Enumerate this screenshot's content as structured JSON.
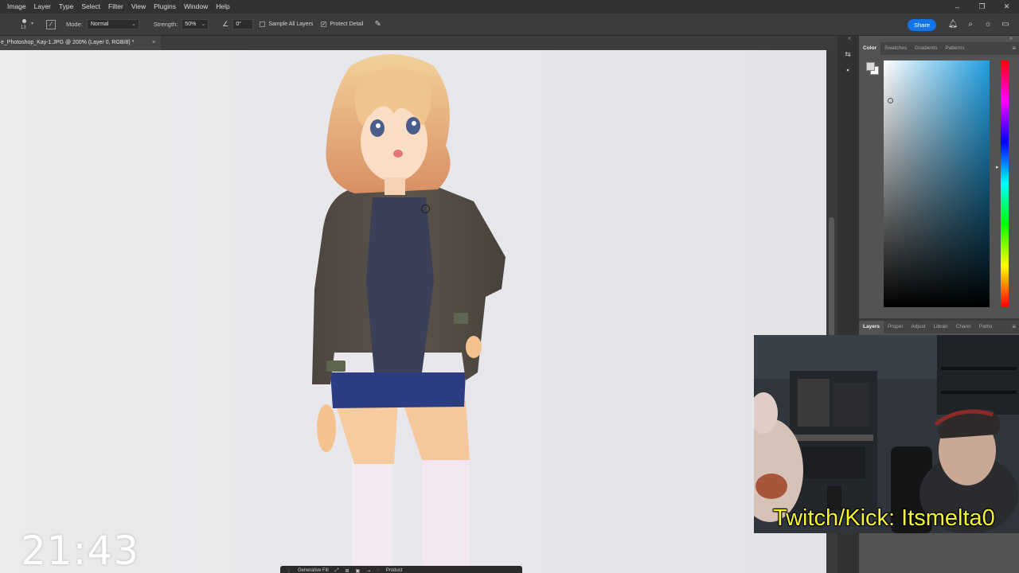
{
  "menu": [
    "Image",
    "Layer",
    "Type",
    "Select",
    "Filter",
    "View",
    "Plugins",
    "Window",
    "Help"
  ],
  "window_controls": {
    "minimize": "–",
    "restore": "❐",
    "close": "✕"
  },
  "options": {
    "brush_size": "13",
    "mode_label": "Mode:",
    "mode_value": "Normal",
    "strength_label": "Strength:",
    "strength_value": "50%",
    "angle_value": "0°",
    "sample_all_layers": "Sample All Layers",
    "sample_all_layers_checked": false,
    "protect_detail": "Protect Detail",
    "protect_detail_checked": true,
    "share": "Share"
  },
  "document_tab": {
    "title": "e_Photoshop_Kay-1.JPG @ 200% (Layer 0, RGB/8) *",
    "close": "×"
  },
  "color_panel": {
    "tabs": [
      "Color",
      "Swatches",
      "Gradients",
      "Patterns"
    ],
    "foreground": "#d9d9d9",
    "background": "#ffffff",
    "field_hue": "#1e9ee0"
  },
  "layers_panel": {
    "tabs": [
      "Layers",
      "Proper",
      "Adjust",
      "Librari",
      "Chann",
      "Paths"
    ]
  },
  "taskbar": {
    "items": [
      "⋮",
      "Generative Fill",
      "⤢",
      "⊞",
      "▣",
      "⇢",
      "◌",
      "Product"
    ]
  },
  "clock": "21:43",
  "webcam": {
    "overlay_text": "Twitch/Kick: Itsmelta0"
  },
  "colors": {
    "accent": "#1473e6",
    "overlay_text": "#f5f52e"
  }
}
